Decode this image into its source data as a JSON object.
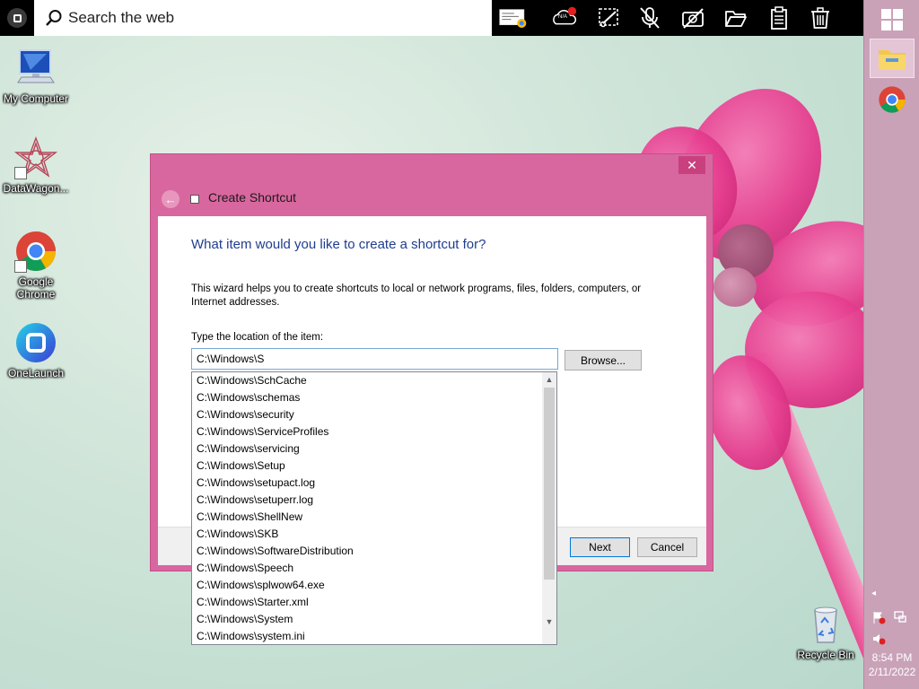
{
  "topbar": {
    "search_placeholder": "Search the web",
    "tools": [
      "screenshot-thumbnail-icon",
      "cloud-status-icon",
      "snip-icon",
      "mic-muted-icon",
      "camera-off-icon",
      "folder-open-icon",
      "clipboard-icon",
      "trash-icon"
    ],
    "cloud_badge": "N/A"
  },
  "desktop_icons": [
    {
      "label": "My Computer"
    },
    {
      "label": "DataWagon..."
    },
    {
      "label": "Google Chrome"
    },
    {
      "label": "OneLaunch"
    },
    {
      "label": "Recycle Bin"
    }
  ],
  "dialog": {
    "title": "Create Shortcut",
    "heading": "What item would you like to create a shortcut for?",
    "description": "This wizard helps you to create shortcuts to local or network programs, files, folders, computers, or Internet addresses.",
    "location_label": "Type the location of the item:",
    "location_value": "C:\\Windows\\S",
    "browse_label": "Browse...",
    "next_label": "Next",
    "cancel_label": "Cancel",
    "close_glyph": "✕"
  },
  "autocomplete": [
    "C:\\Windows\\SchCache",
    "C:\\Windows\\schemas",
    "C:\\Windows\\security",
    "C:\\Windows\\ServiceProfiles",
    "C:\\Windows\\servicing",
    "C:\\Windows\\Setup",
    "C:\\Windows\\setupact.log",
    "C:\\Windows\\setuperr.log",
    "C:\\Windows\\ShellNew",
    "C:\\Windows\\SKB",
    "C:\\Windows\\SoftwareDistribution",
    "C:\\Windows\\Speech",
    "C:\\Windows\\splwow64.exe",
    "C:\\Windows\\Starter.xml",
    "C:\\Windows\\System",
    "C:\\Windows\\system.ini"
  ],
  "tray": {
    "time": "8:54 PM",
    "date": "2/11/2022"
  },
  "colors": {
    "dialog_frame": "#d9679f",
    "heading": "#1f3d8f",
    "taskbar": "#c9a2b8"
  }
}
